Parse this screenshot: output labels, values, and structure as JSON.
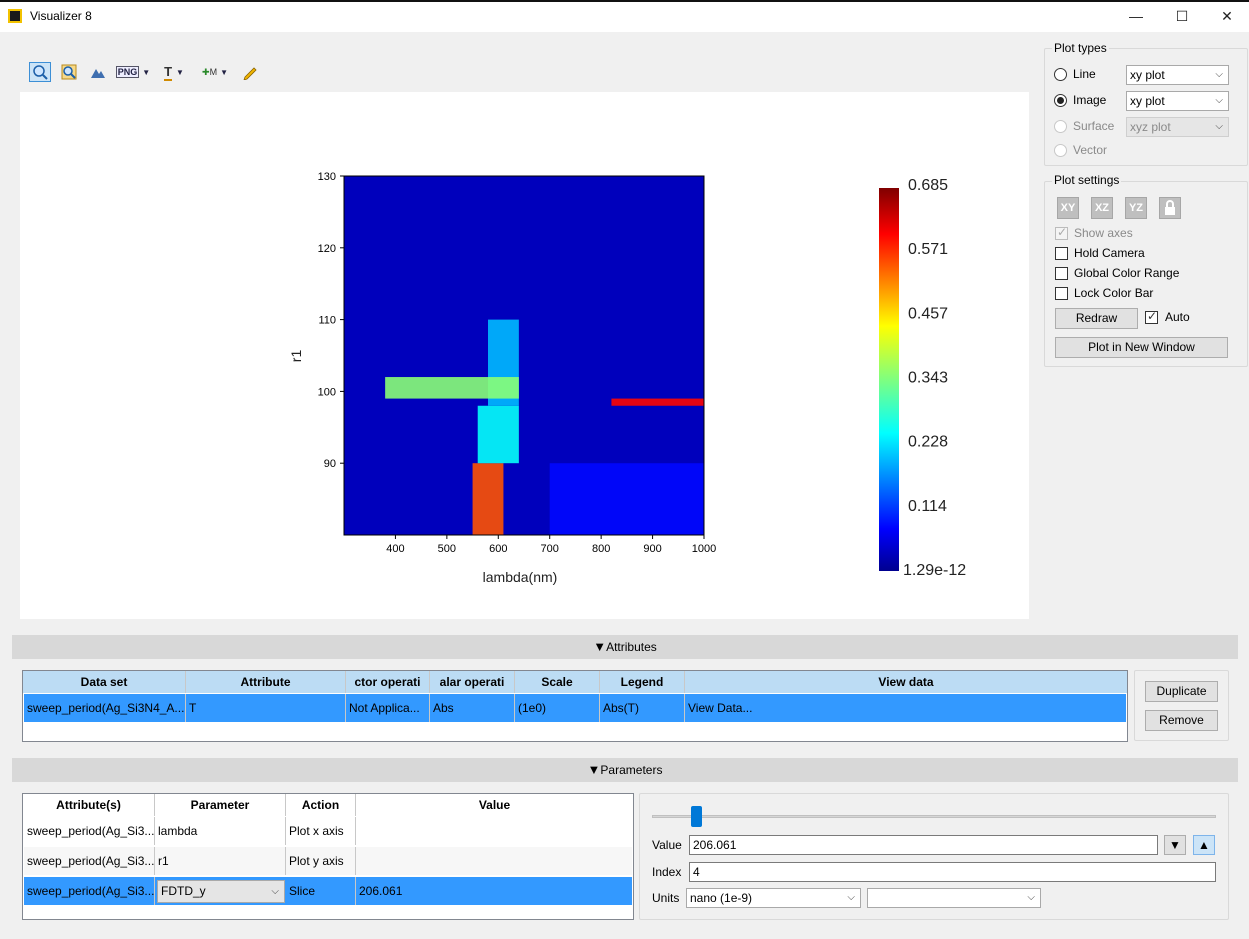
{
  "window": {
    "title": "Visualizer 8",
    "minimize_glyph": "—",
    "maximize_glyph": "☐",
    "close_glyph": "✕"
  },
  "toolbar": {
    "icons": [
      "zoom-extents-icon",
      "zoom-icon",
      "mountain-view-icon",
      "png-export-icon",
      "text-icon",
      "marker-icon",
      "pencil-icon"
    ],
    "png_label": "PNG",
    "text_label": "T",
    "marker_label": "M"
  },
  "colors": {
    "selection": "#3399ff",
    "header_blue": "#bcdcf4"
  },
  "plot_types": {
    "title": "Plot types",
    "rows": [
      {
        "label": "Line",
        "selected": false,
        "enabled": true,
        "combo": "xy plot",
        "combo_enabled": true
      },
      {
        "label": "Image",
        "selected": true,
        "enabled": true,
        "combo": "xy plot",
        "combo_enabled": true
      },
      {
        "label": "Surface",
        "selected": false,
        "enabled": false,
        "combo": "xyz plot",
        "combo_enabled": false
      },
      {
        "label": "Vector",
        "selected": false,
        "enabled": false
      }
    ]
  },
  "plot_settings": {
    "title": "Plot settings",
    "view_buttons": [
      "XY",
      "XZ",
      "YZ"
    ],
    "show_axes": "Show axes",
    "hold_camera": "Hold Camera",
    "global_color_range": "Global Color Range",
    "lock_color_bar": "Lock Color Bar",
    "redraw": "Redraw",
    "auto": "Auto",
    "plot_new_window": "Plot in New Window"
  },
  "attributes": {
    "header": "Attributes",
    "columns": [
      "Data set",
      "Attribute",
      "ctor operati",
      "alar operati",
      "Scale",
      "Legend",
      "View data"
    ],
    "rows": [
      [
        "sweep_period(Ag_Si3N4_A...",
        "T",
        "Not Applica...",
        "Abs",
        "(1e0)",
        "Abs(T)",
        "View Data..."
      ]
    ],
    "duplicate": "Duplicate",
    "remove": "Remove"
  },
  "parameters": {
    "header": "Parameters",
    "columns": [
      "Attribute(s)",
      "Parameter",
      "Action",
      "Value"
    ],
    "rows": [
      {
        "attr": "sweep_period(Ag_Si3...",
        "param": "lambda",
        "action": "Plot x axis",
        "value": ""
      },
      {
        "attr": "sweep_period(Ag_Si3...",
        "param": "r1",
        "action": "Plot y axis",
        "value": ""
      },
      {
        "attr": "sweep_period(Ag_Si3...",
        "param": "FDTD_y",
        "action": "Slice",
        "value": "206.061"
      }
    ],
    "value_label": "Value",
    "value": "206.061",
    "index_label": "Index",
    "index": "4",
    "units_label": "Units",
    "units": "nano (1e-9)",
    "units2": "",
    "slider_position": 0.04
  },
  "chart_data": {
    "type": "heatmap",
    "xlabel": "lambda(nm)",
    "ylabel": "r1",
    "x_ticks": [
      "400",
      "500",
      "600",
      "700",
      "800",
      "900",
      "1000"
    ],
    "y_ticks": [
      "90",
      "100",
      "110",
      "120",
      "130"
    ],
    "xlim": [
      300,
      1000
    ],
    "ylim": [
      80,
      130
    ],
    "colorbar": {
      "labels": [
        "0.685",
        "0.571",
        "0.457",
        "0.343",
        "0.228",
        "0.114",
        "1.29e-12"
      ],
      "min": 1.29e-12,
      "max": 0.685,
      "colormap": "jet"
    },
    "background_value": 0.03,
    "features": [
      {
        "desc": "band",
        "lambda": [
          550,
          610
        ],
        "r1": [
          80,
          90
        ],
        "value": 0.55
      },
      {
        "desc": "band",
        "lambda": [
          560,
          640
        ],
        "r1": [
          90,
          98
        ],
        "value": 0.25
      },
      {
        "desc": "band",
        "lambda": [
          580,
          640
        ],
        "r1": [
          98,
          110
        ],
        "value": 0.2
      },
      {
        "desc": "line",
        "lambda": [
          820,
          1000
        ],
        "r1": [
          98,
          99
        ],
        "value": 0.6
      },
      {
        "desc": "line",
        "lambda": [
          380,
          640
        ],
        "r1": [
          99,
          102
        ],
        "value": 0.35
      },
      {
        "desc": "faint",
        "lambda": [
          700,
          1000
        ],
        "r1": [
          80,
          90
        ],
        "value": 0.08
      }
    ]
  }
}
